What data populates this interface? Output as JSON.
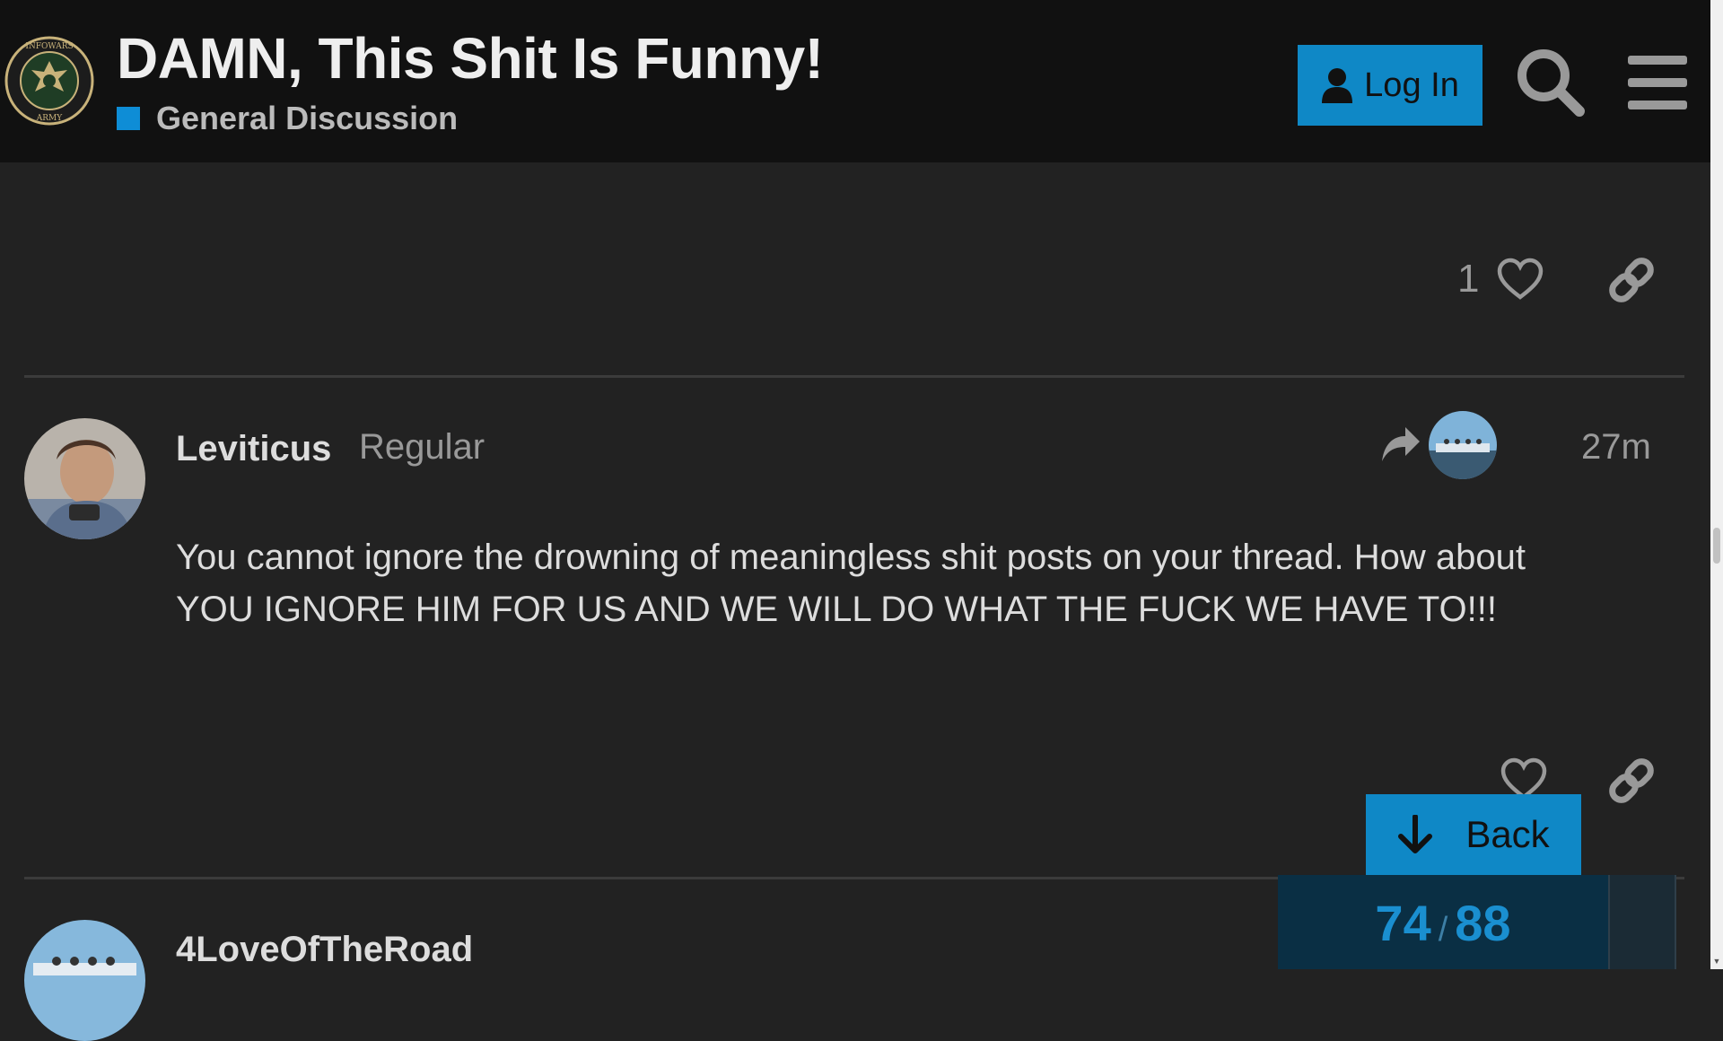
{
  "header": {
    "topic_title": "DAMN, This Shit Is Funny!",
    "category": {
      "label": "General Discussion",
      "color": "#0e8dd6"
    },
    "login_label": "Log In",
    "logo_name": "infowars-army-seal-logo",
    "logo_text_top": "INFOWARS",
    "logo_text_bottom": "ARMY"
  },
  "posts": [
    {
      "like_count": "1",
      "actions": [
        "heart-icon",
        "link-icon"
      ]
    },
    {
      "username": "Leviticus",
      "user_title": "Regular",
      "time": "27m",
      "reply_to_icon": "share-arrow-icon",
      "body": "You cannot ignore the drowning of meaningless shit posts on your thread. How about YOU IGNORE HIM FOR US AND WE WILL DO WHAT THE FUCK WE HAVE TO!!!",
      "actions": [
        "heart-icon",
        "link-icon"
      ]
    },
    {
      "username": "4LoveOfTheRoad"
    }
  ],
  "timeline": {
    "back_label": "Back",
    "current": "74",
    "separator": "/",
    "total": "88"
  },
  "colors": {
    "accent": "#0f88c6",
    "header_bg": "#111111",
    "page_bg": "#222222",
    "progress_bg": "#0a2f44"
  }
}
